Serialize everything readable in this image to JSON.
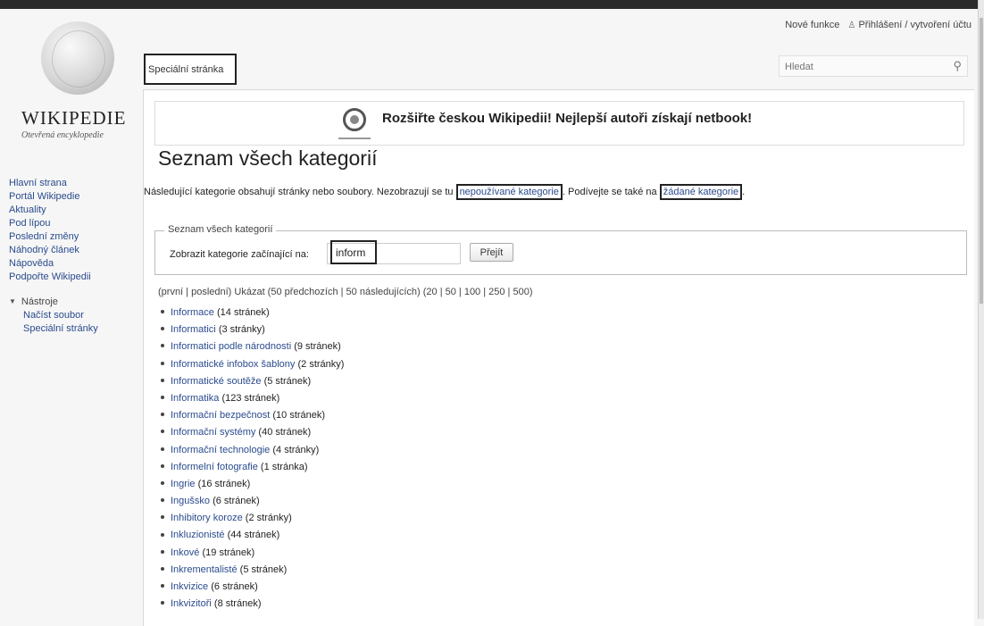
{
  "header": {
    "personal_links": [
      "Nové funkce",
      "Přihlášení / vytvoření účtu"
    ]
  },
  "logo": {
    "wordmark": "WIKIPEDIE",
    "tagline": "Otevřená encyklopedie"
  },
  "sidebar": {
    "items": [
      {
        "label": "Hlavní strana"
      },
      {
        "label": "Portál Wikipedie"
      },
      {
        "label": "Aktuality"
      },
      {
        "label": "Pod lípou"
      },
      {
        "label": "Poslední změny"
      },
      {
        "label": "Náhodný článek"
      },
      {
        "label": "Nápověda"
      },
      {
        "label": "Podpořte Wikipedii"
      }
    ],
    "tools_label": "Nástroje",
    "tools": [
      {
        "label": "Načíst soubor"
      },
      {
        "label": "Speciální stránky"
      }
    ]
  },
  "tab": {
    "label": "Speciální stránka"
  },
  "search": {
    "placeholder": "Hledat"
  },
  "banner": {
    "text": "Rozšiřte českou Wikipedii! Nejlepší autoři získají netbook!"
  },
  "page": {
    "title": "Seznam všech kategorií",
    "intro_part1": "Následující kategorie obsahují stránky nebo soubory. Nezobrazují se tu",
    "intro_link1": "nepoužívané kategorie",
    "intro_part2": ". Podívejte se také na",
    "intro_link2": "žádané kategorie",
    "intro_part3": "."
  },
  "form": {
    "legend": "Seznam všech kategorií",
    "label": "Zobrazit kategorie začínající na:",
    "input_value": "inform",
    "button": "Přejít"
  },
  "nav": {
    "prefix": "(první | poslední) Ukázat (50 předchozích | 50 následujících) (20 | 50 | 100 | 250 | 500)"
  },
  "categories": [
    {
      "name": "Informace",
      "count": "(14 stránek)"
    },
    {
      "name": "Informatici",
      "count": "(3 stránky)"
    },
    {
      "name": "Informatici podle národnosti",
      "count": "(9 stránek)"
    },
    {
      "name": "Informatické infobox šablony",
      "count": "(2 stránky)"
    },
    {
      "name": "Informatické soutěže",
      "count": "(5 stránek)"
    },
    {
      "name": "Informatika",
      "count": "(123 stránek)"
    },
    {
      "name": "Informační bezpečnost",
      "count": "(10 stránek)"
    },
    {
      "name": "Informační systémy",
      "count": "(40 stránek)"
    },
    {
      "name": "Informační technologie",
      "count": "(4 stránky)"
    },
    {
      "name": "Informelní fotografie",
      "count": "(1 stránka)"
    },
    {
      "name": "Ingrie",
      "count": "(16 stránek)"
    },
    {
      "name": "Ingušsko",
      "count": "(6 stránek)"
    },
    {
      "name": "Inhibitory koroze",
      "count": "(2 stránky)"
    },
    {
      "name": "Inkluzionisté",
      "count": "(44 stránek)"
    },
    {
      "name": "Inkové",
      "count": "(19 stránek)"
    },
    {
      "name": "Inkrementalisté",
      "count": "(5 stránek)"
    },
    {
      "name": "Inkvizice",
      "count": "(6 stránek)"
    },
    {
      "name": "Inkvizitoři",
      "count": "(8 stránek)"
    }
  ]
}
